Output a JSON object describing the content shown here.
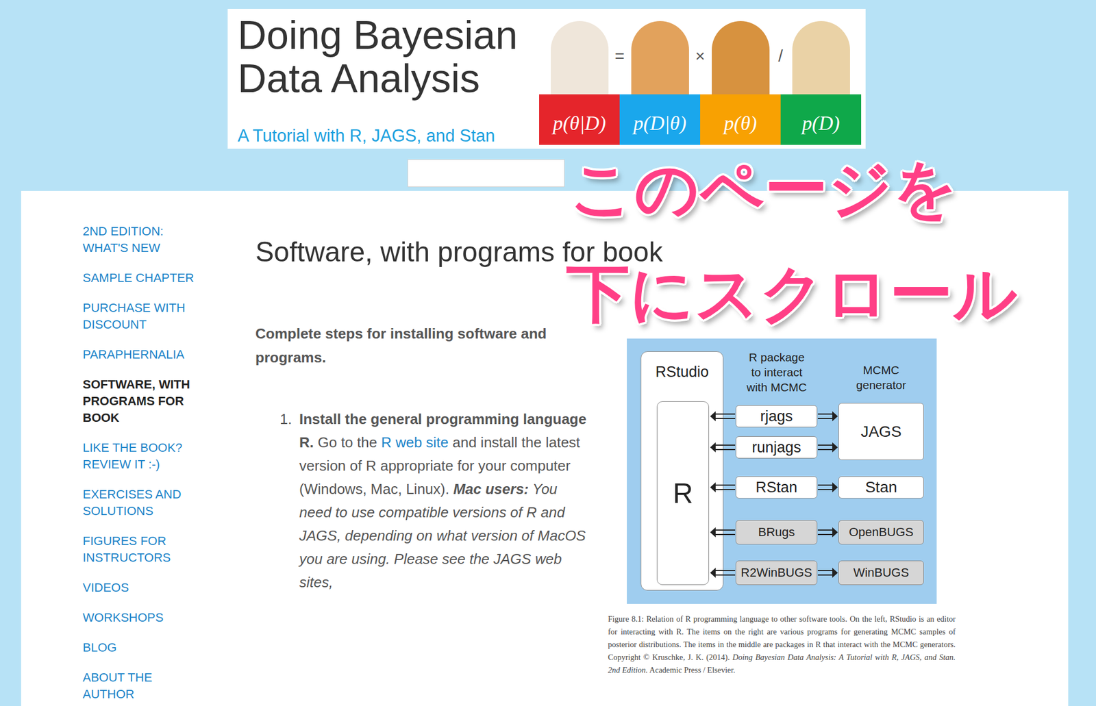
{
  "banner": {
    "title_lines": [
      "Doing Bayesian",
      "Data Analysis"
    ],
    "subtitle": "A Tutorial with R, JAGS, and Stan",
    "equation": [
      {
        "label": "p(θ|D)",
        "color": "#e5252b",
        "operator": "="
      },
      {
        "label": "p(D|θ)",
        "color": "#1aa7ec",
        "operator": "×"
      },
      {
        "label": "p(θ)",
        "color": "#f8a102",
        "operator": "/"
      },
      {
        "label": "p(D)",
        "color": "#0fa84a"
      }
    ]
  },
  "sidebar": {
    "items": [
      {
        "lines": [
          "2ND EDITION:",
          "WHAT'S NEW"
        ],
        "selected": false
      },
      {
        "lines": [
          "SAMPLE CHAPTER"
        ],
        "selected": false
      },
      {
        "lines": [
          "PURCHASE WITH",
          "DISCOUNT"
        ],
        "selected": false
      },
      {
        "lines": [
          "PARAPHERNALIA"
        ],
        "selected": false
      },
      {
        "lines": [
          "SOFTWARE, WITH",
          "PROGRAMS FOR",
          "BOOK"
        ],
        "selected": true
      },
      {
        "lines": [
          "LIKE THE BOOK?",
          "REVIEW IT :-)"
        ],
        "selected": false
      },
      {
        "lines": [
          "EXERCISES AND",
          "SOLUTIONS"
        ],
        "selected": false
      },
      {
        "lines": [
          "FIGURES FOR",
          "INSTRUCTORS"
        ],
        "selected": false
      },
      {
        "lines": [
          "VIDEOS"
        ],
        "selected": false
      },
      {
        "lines": [
          "WORKSHOPS"
        ],
        "selected": false
      },
      {
        "lines": [
          "BLOG"
        ],
        "selected": false
      },
      {
        "lines": [
          "ABOUT THE",
          "AUTHOR"
        ],
        "selected": false
      }
    ]
  },
  "page": {
    "title": "Software, with programs for book",
    "intro": "Complete steps for installing software and programs.",
    "steps": [
      {
        "number": "1.",
        "segments": [
          {
            "text": "Install the general programming language R.",
            "kind": "bold"
          },
          {
            "text": " Go to the ",
            "kind": "normal"
          },
          {
            "text": "R web site",
            "kind": "link"
          },
          {
            "text": " and install the latest version of R appropriate for your computer (Windows, Mac, Linux). ",
            "kind": "normal"
          },
          {
            "text": "Mac users:",
            "kind": "bold-italic"
          },
          {
            "text": " You need to use compatible versions of R and JAGS, depending on what version of MacOS you are using. Please see the JAGS web sites,",
            "kind": "italic"
          }
        ]
      }
    ]
  },
  "figure": {
    "rstudio": "RStudio",
    "r": "R",
    "middle_header": [
      "R package",
      "to interact",
      "with MCMC"
    ],
    "right_header": [
      "MCMC",
      "generator"
    ],
    "packages": [
      {
        "name": "rjags",
        "greyed": false
      },
      {
        "name": "runjags",
        "greyed": false
      },
      {
        "name": "RStan",
        "greyed": false
      },
      {
        "name": "BRugs",
        "greyed": true
      },
      {
        "name": "R2WinBUGS",
        "greyed": true
      }
    ],
    "generators": [
      {
        "name": "JAGS",
        "greyed": false
      },
      {
        "name": "Stan",
        "greyed": false
      },
      {
        "name": "OpenBUGS",
        "greyed": true
      },
      {
        "name": "WinBUGS",
        "greyed": true
      }
    ],
    "caption": [
      {
        "text": "Figure 8.1: Relation of R programming language to other software tools. On the left, RStudio is an editor for interacting with R. The items on the right are various programs for generating MCMC samples of posterior distributions. The items in the middle are packages in R that interact with the MCMC generators.  Copyright © Kruschke, J. K. (2014). ",
        "italic": false
      },
      {
        "text": "Doing Bayesian Data Analysis: A Tutorial with R, JAGS, and Stan. 2nd Edition.",
        "italic": true
      },
      {
        "text": " Academic Press / Elsevier.",
        "italic": false
      }
    ]
  },
  "annotation": {
    "lines": [
      "このページを",
      "下にスクロール"
    ]
  }
}
